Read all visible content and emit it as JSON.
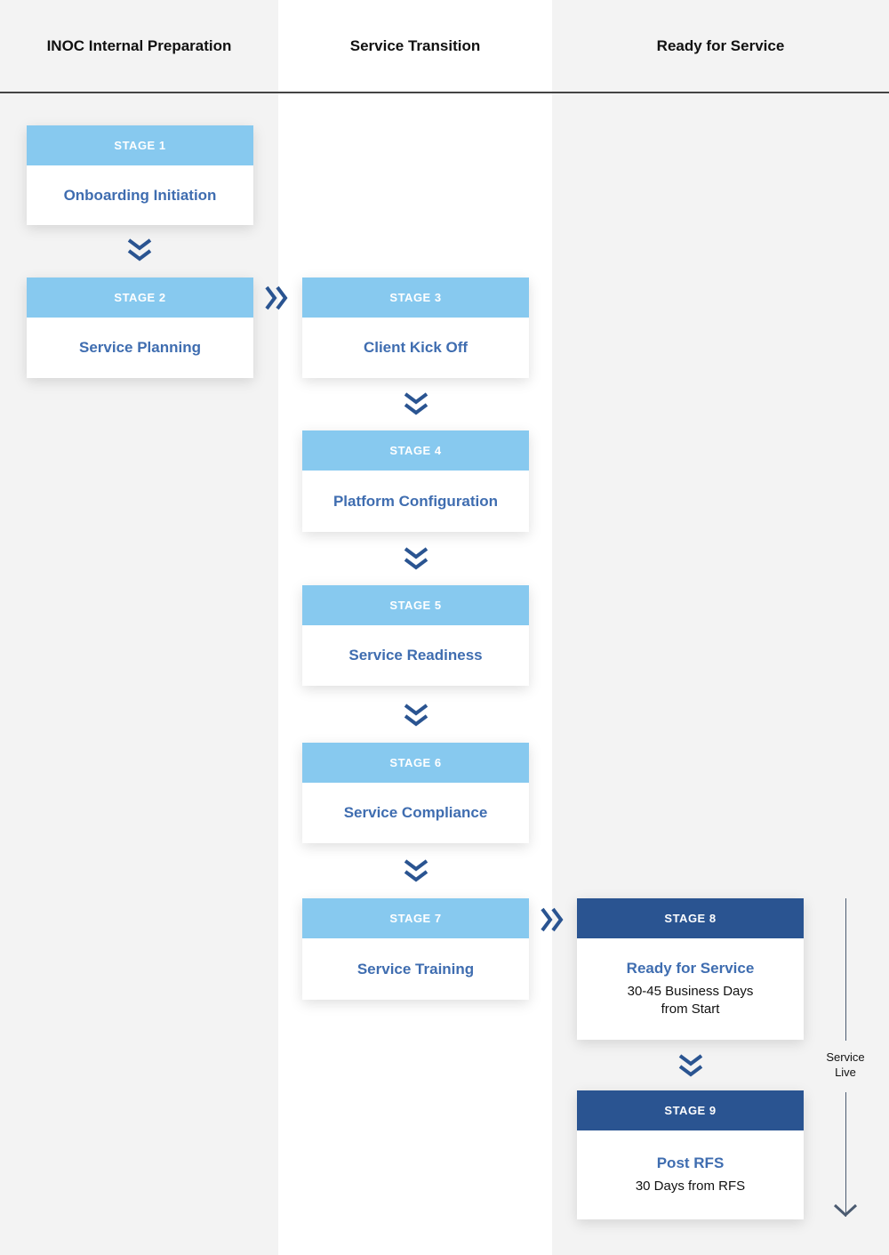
{
  "columns": [
    {
      "label": "INOC Internal Preparation"
    },
    {
      "label": "Service Transition"
    },
    {
      "label": "Ready for Service"
    }
  ],
  "stages": [
    {
      "header": "STAGE 1",
      "title": "Onboarding Initiation",
      "column": 1
    },
    {
      "header": "STAGE 2",
      "title": "Service Planning",
      "column": 1
    },
    {
      "header": "STAGE 3",
      "title": "Client Kick Off",
      "column": 2
    },
    {
      "header": "STAGE 4",
      "title": "Platform Configuration",
      "column": 2
    },
    {
      "header": "STAGE 5",
      "title": "Service Readiness",
      "column": 2
    },
    {
      "header": "STAGE 6",
      "title": "Service Compliance",
      "column": 2
    },
    {
      "header": "STAGE 7",
      "title": "Service Training",
      "column": 2
    },
    {
      "header": "STAGE 8",
      "title": "Ready for Service",
      "subtitle_line1": "30-45 Business Days",
      "subtitle_line2": "from Start",
      "column": 3
    },
    {
      "header": "STAGE 9",
      "title": "Post RFS",
      "subtitle_line1": "30 Days from RFS",
      "column": 3
    }
  ],
  "service_live": {
    "line1": "Service",
    "line2": "Live"
  },
  "colors": {
    "light_header": "#87c9ef",
    "dark_header": "#2a5491",
    "title_text": "#3f6db0",
    "arrow": "#2a5491"
  }
}
